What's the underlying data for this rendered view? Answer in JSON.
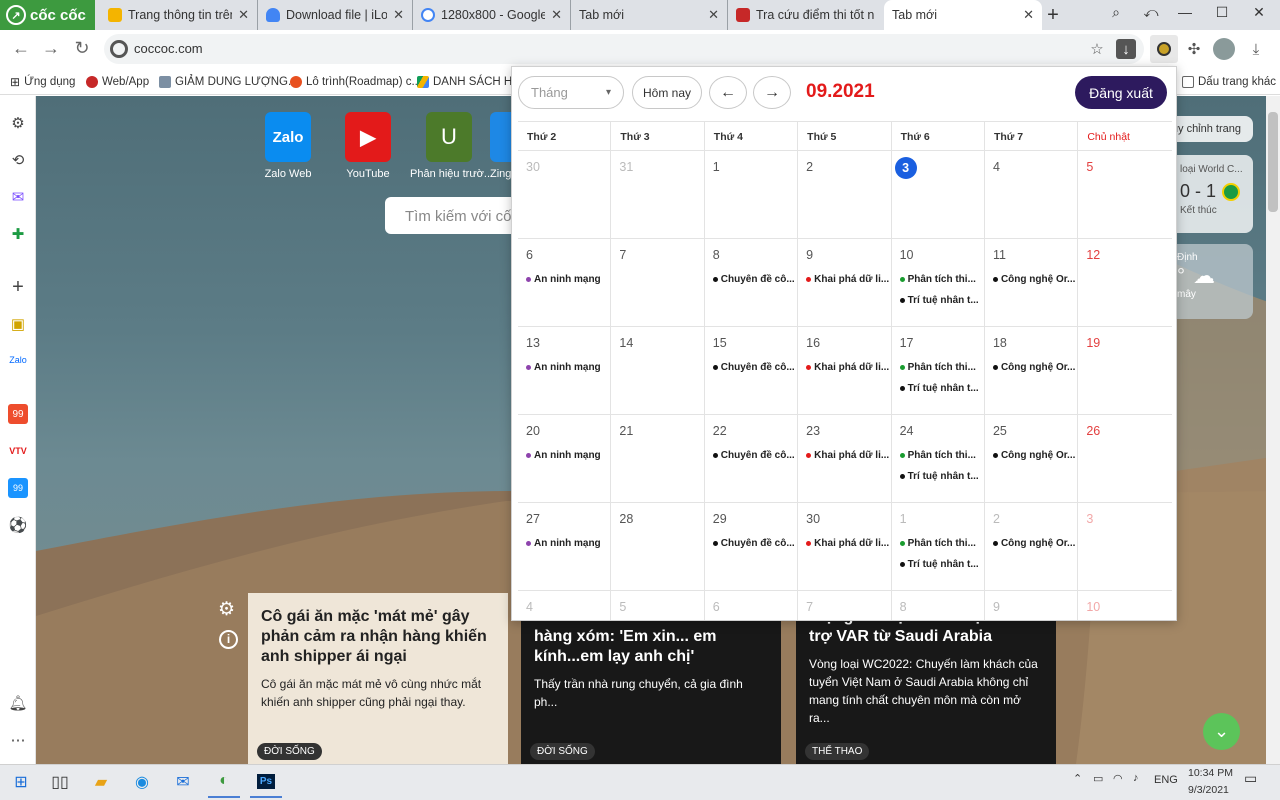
{
  "browser": {
    "brand": "cốc cốc",
    "tabs": [
      {
        "title": "Trang thông tin trên",
        "close": "✕"
      },
      {
        "title": "Download file | iLove",
        "close": "✕"
      },
      {
        "title": "1280x800 - Google T",
        "close": "✕"
      },
      {
        "title": "Tab mới",
        "close": "✕"
      },
      {
        "title": "Tra cứu điểm thi tốt n",
        "close": "✕"
      },
      {
        "title": "Tab mới",
        "close": "✕"
      }
    ],
    "new_tab": "+",
    "url": "coccoc.com",
    "bookmarks": [
      {
        "label": "Ứng dụng"
      },
      {
        "label": "Web/App"
      },
      {
        "label": "GIẢM DUNG LƯỢNG..."
      },
      {
        "label": "Lô trình(Roadmap) c..."
      },
      {
        "label": "DANH SÁCH HỌC"
      },
      {
        "label": "Dấu trang khác"
      }
    ]
  },
  "newtab": {
    "shortcuts": [
      {
        "label": "Zalo Web",
        "tile": "Zalo"
      },
      {
        "label": "YouTube",
        "tile": "▶"
      },
      {
        "label": "Phân hiệu trườ...",
        "tile": "U"
      },
      {
        "label": "Zing",
        "tile": ""
      }
    ],
    "search_placeholder": "Tìm kiếm với cố",
    "customize_label": "Tùy chỉnh trang",
    "match_widget": {
      "title": "loại World C...",
      "score": "0 - 1",
      "status": "Kết thúc"
    },
    "weather_widget": {
      "place": "Định",
      "temp": "°",
      "cloud": "mây"
    },
    "news": [
      {
        "title": "Cô gái ăn mặc 'mát mẻ' gây phản cảm ra nhận hàng khiến anh shipper ái ngại",
        "summary": "Cô gái ăn mặc mát mẻ vô cùng nhức mắt khiến anh shipper cũng phải ngại thay.",
        "category": "ĐỜI SỐNG"
      },
      {
        "title": "Thanh niên trổ tài lau bàn thờ hàng xóm: 'Em xin... em kính...em lạy anh chị'",
        "summary": "Thấy trần nhà rung chuyển, cả gia đình ph...",
        "category": "ĐỜI SỐNG"
      },
      {
        "title": "Trọng tài Việt Nam nhận hỗ trợ VAR từ Saudi Arabia",
        "summary": "Vòng loại WC2022: Chuyến làm khách của tuyển Việt Nam ở Saudi Arabia không chỉ mang tính chất chuyên môn mà còn mở ra...",
        "category": "THỂ THAO"
      }
    ]
  },
  "calendar": {
    "month_select_placeholder": "Tháng",
    "today_button": "Hôm nay",
    "prev_arrow": "←",
    "next_arrow": "→",
    "current_month": "09.2021",
    "logout_button": "Đăng xuất",
    "weekdays": [
      "Thứ 2",
      "Thứ 3",
      "Thứ 4",
      "Thứ 5",
      "Thứ 6",
      "Thứ 7",
      "Chủ nhật"
    ],
    "event_colors": {
      "purple": "#8e44ad",
      "black": "#111111",
      "red": "#e31a1a",
      "green": "#1a9c2f"
    },
    "weeks": [
      {
        "days": [
          {
            "num": "30",
            "other": true,
            "events": []
          },
          {
            "num": "31",
            "other": true,
            "events": []
          },
          {
            "num": "1",
            "events": []
          },
          {
            "num": "2",
            "events": []
          },
          {
            "num": "3",
            "today": true,
            "events": []
          },
          {
            "num": "4",
            "events": []
          },
          {
            "num": "5",
            "sun": true,
            "events": []
          }
        ]
      },
      {
        "days": [
          {
            "num": "6",
            "events": [
              {
                "text": "An ninh mạng",
                "color": "#8e44ad"
              }
            ]
          },
          {
            "num": "7",
            "events": []
          },
          {
            "num": "8",
            "events": [
              {
                "text": "Chuyên đề cô...",
                "color": "#111111"
              }
            ]
          },
          {
            "num": "9",
            "events": [
              {
                "text": "Khai phá dữ li...",
                "color": "#e31a1a"
              }
            ]
          },
          {
            "num": "10",
            "events": [
              {
                "text": "Phân tích thi...",
                "color": "#1a9c2f"
              },
              {
                "text": "Trí tuệ nhân t...",
                "color": "#111111"
              }
            ]
          },
          {
            "num": "11",
            "events": [
              {
                "text": "Công nghệ Or...",
                "color": "#111111"
              }
            ]
          },
          {
            "num": "12",
            "sun": true,
            "events": []
          }
        ]
      },
      {
        "days": [
          {
            "num": "13",
            "events": [
              {
                "text": "An ninh mạng",
                "color": "#8e44ad"
              }
            ]
          },
          {
            "num": "14",
            "events": []
          },
          {
            "num": "15",
            "events": [
              {
                "text": "Chuyên đề cô...",
                "color": "#111111"
              }
            ]
          },
          {
            "num": "16",
            "events": [
              {
                "text": "Khai phá dữ li...",
                "color": "#e31a1a"
              }
            ]
          },
          {
            "num": "17",
            "events": [
              {
                "text": "Phân tích thi...",
                "color": "#1a9c2f"
              },
              {
                "text": "Trí tuệ nhân t...",
                "color": "#111111"
              }
            ]
          },
          {
            "num": "18",
            "events": [
              {
                "text": "Công nghệ Or...",
                "color": "#111111"
              }
            ]
          },
          {
            "num": "19",
            "sun": true,
            "events": []
          }
        ]
      },
      {
        "days": [
          {
            "num": "20",
            "events": [
              {
                "text": "An ninh mạng",
                "color": "#8e44ad"
              }
            ]
          },
          {
            "num": "21",
            "events": []
          },
          {
            "num": "22",
            "events": [
              {
                "text": "Chuyên đề cô...",
                "color": "#111111"
              }
            ]
          },
          {
            "num": "23",
            "events": [
              {
                "text": "Khai phá dữ li...",
                "color": "#e31a1a"
              }
            ]
          },
          {
            "num": "24",
            "events": [
              {
                "text": "Phân tích thi...",
                "color": "#1a9c2f"
              },
              {
                "text": "Trí tuệ nhân t...",
                "color": "#111111"
              }
            ]
          },
          {
            "num": "25",
            "events": [
              {
                "text": "Công nghệ Or...",
                "color": "#111111"
              }
            ]
          },
          {
            "num": "26",
            "sun": true,
            "events": []
          }
        ]
      },
      {
        "days": [
          {
            "num": "27",
            "events": [
              {
                "text": "An ninh mạng",
                "color": "#8e44ad"
              }
            ]
          },
          {
            "num": "28",
            "events": []
          },
          {
            "num": "29",
            "events": [
              {
                "text": "Chuyên đề cô...",
                "color": "#111111"
              }
            ]
          },
          {
            "num": "30",
            "events": [
              {
                "text": "Khai phá dữ li...",
                "color": "#e31a1a"
              }
            ]
          },
          {
            "num": "1",
            "other": true,
            "events": [
              {
                "text": "Phân tích thi...",
                "color": "#1a9c2f"
              },
              {
                "text": "Trí tuệ nhân t...",
                "color": "#111111"
              }
            ]
          },
          {
            "num": "2",
            "other": true,
            "events": [
              {
                "text": "Công nghệ Or...",
                "color": "#111111"
              }
            ]
          },
          {
            "num": "3",
            "other": true,
            "sun": true,
            "events": []
          }
        ]
      },
      {
        "days": [
          {
            "num": "4",
            "other": true,
            "events": []
          },
          {
            "num": "5",
            "other": true,
            "events": []
          },
          {
            "num": "6",
            "other": true,
            "events": []
          },
          {
            "num": "7",
            "other": true,
            "events": []
          },
          {
            "num": "8",
            "other": true,
            "events": []
          },
          {
            "num": "9",
            "other": true,
            "events": []
          },
          {
            "num": "10",
            "other": true,
            "sun": true,
            "events": []
          }
        ]
      }
    ]
  },
  "taskbar": {
    "language": "ENG",
    "time": "10:34 PM",
    "date": "9/3/2021"
  }
}
